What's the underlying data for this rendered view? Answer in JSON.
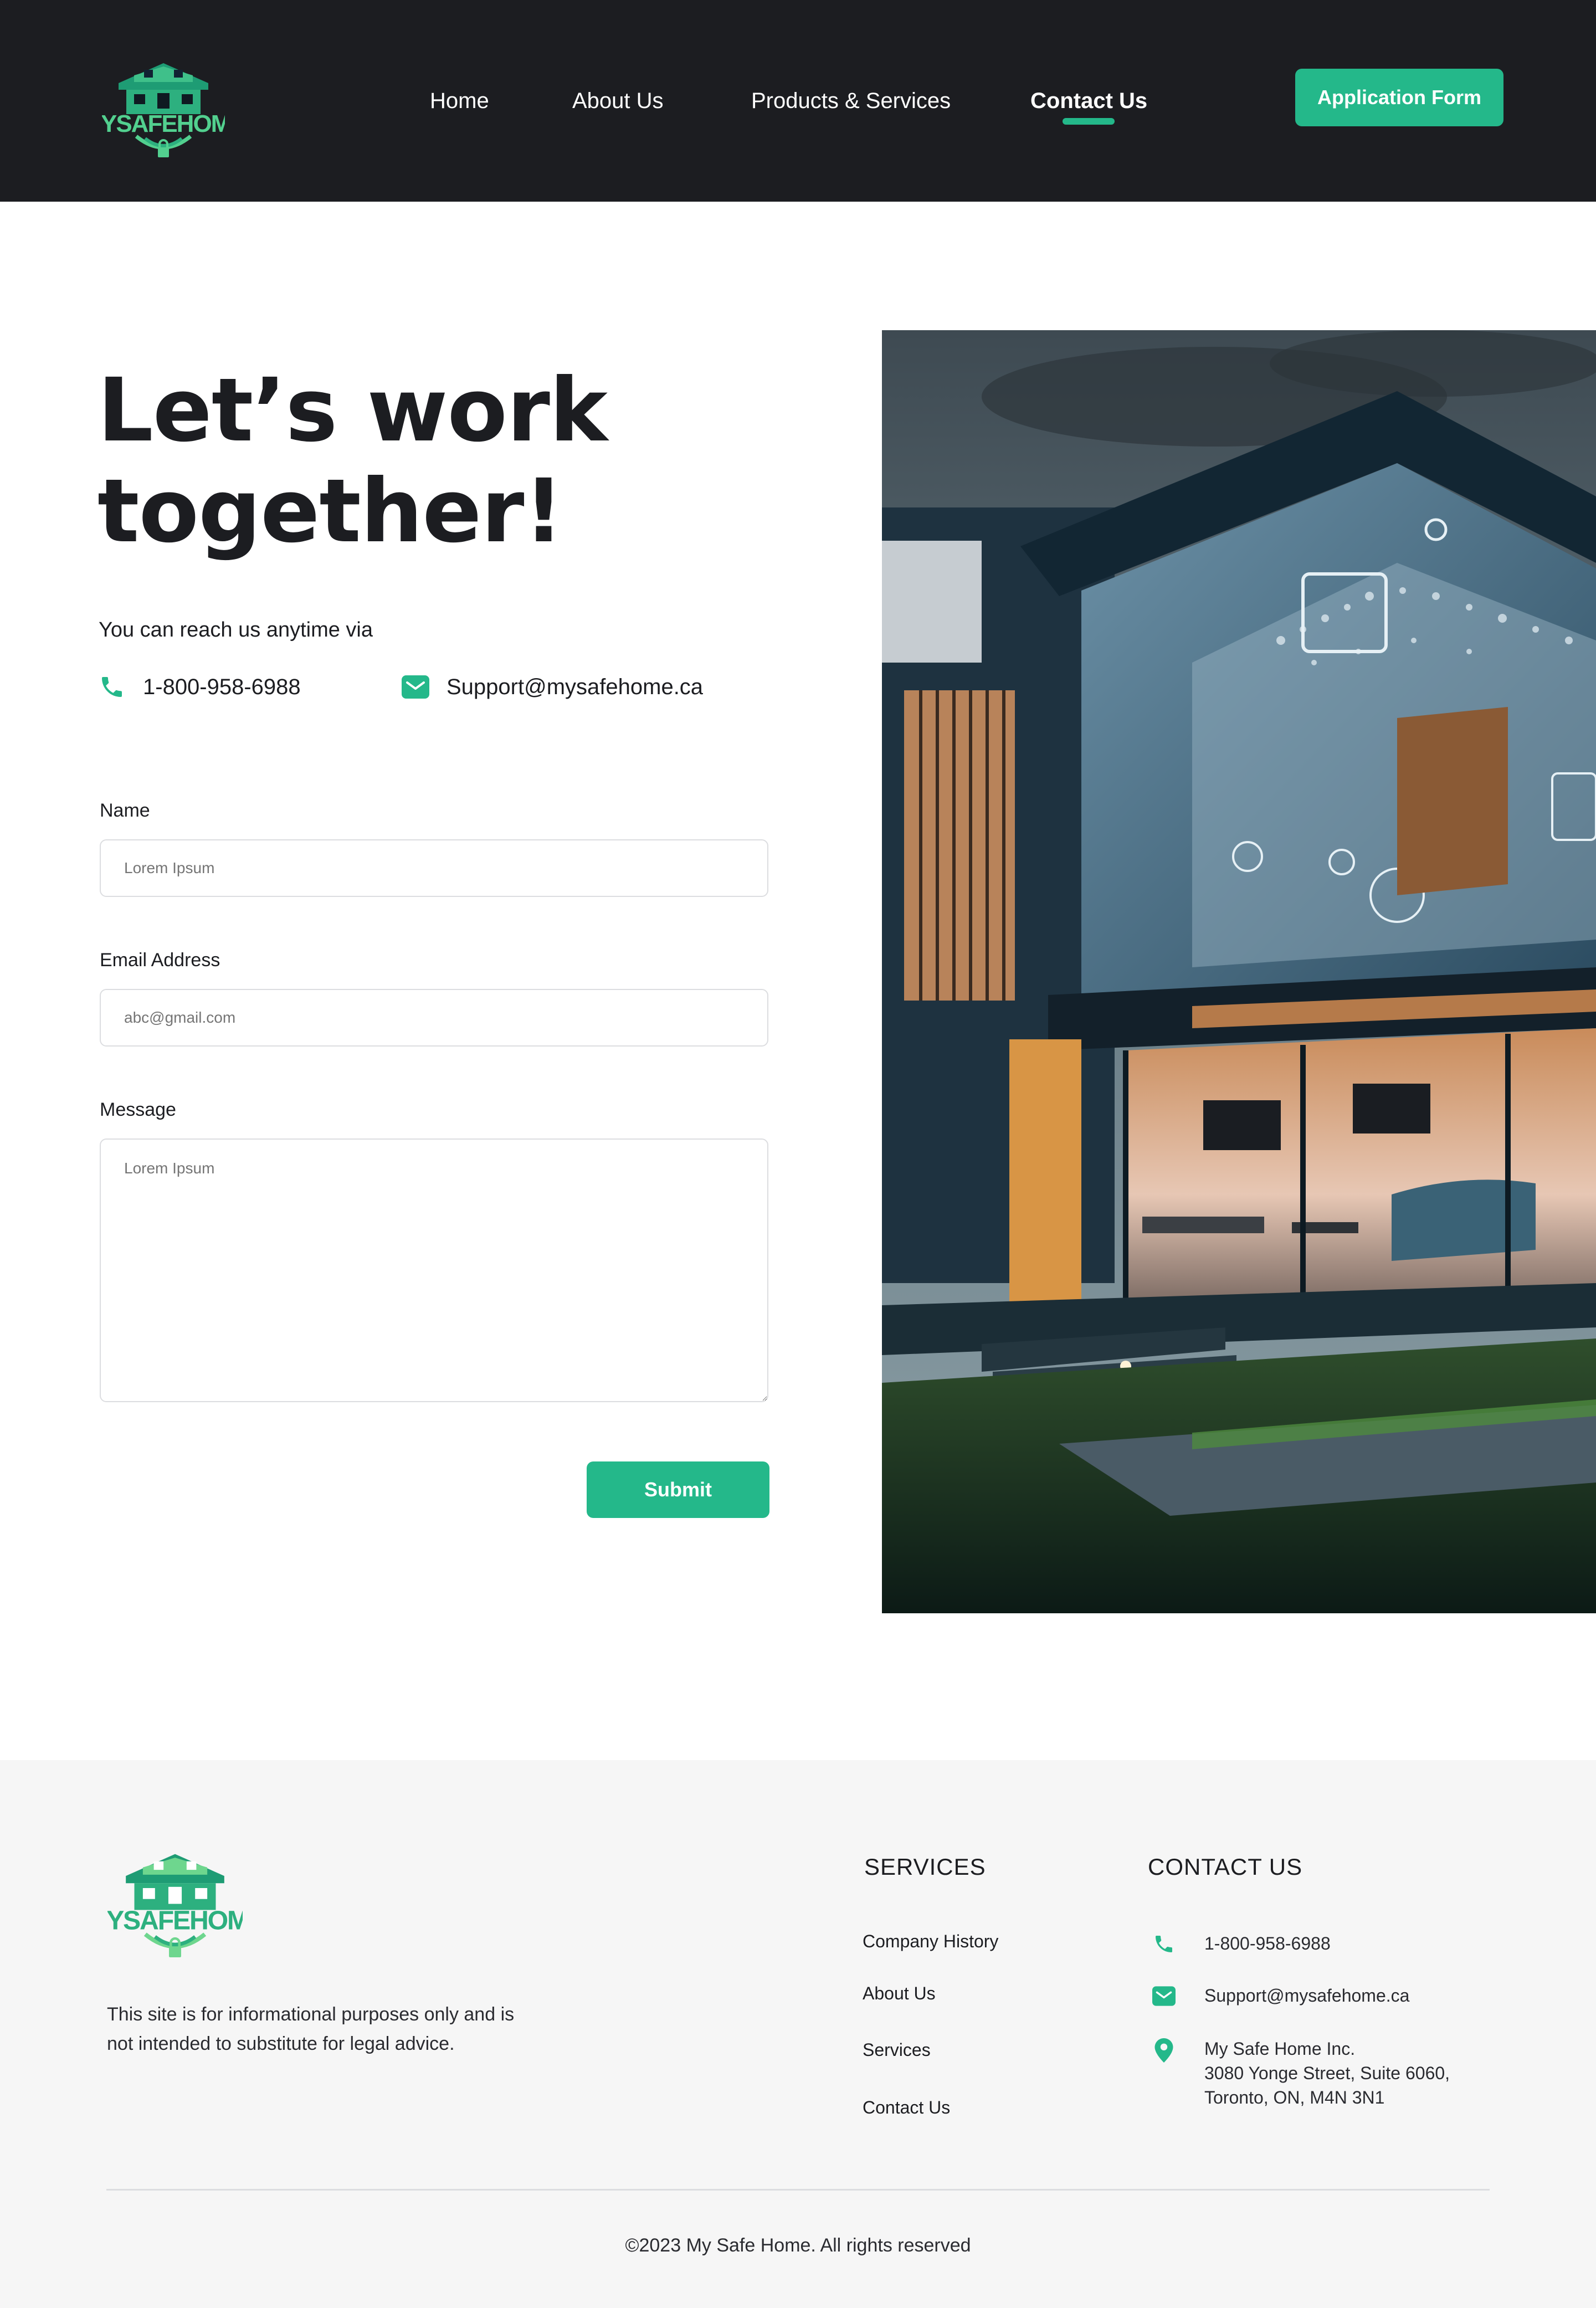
{
  "brand": {
    "logo_text": "MYSAFEHOME",
    "accent": "#24b88a",
    "dark": "#1c1d21"
  },
  "nav": {
    "items": [
      {
        "label": "Home"
      },
      {
        "label": "About  Us"
      },
      {
        "label": "Products & Services"
      },
      {
        "label": "Contact Us",
        "active": true
      }
    ],
    "cta_label": "Application Form"
  },
  "hero": {
    "title_line1": "Let’s work",
    "title_line2": "together!",
    "reach_text": "You can reach us anytime via",
    "phone": "1-800-958-6988",
    "email": "Support@mysafehome.ca"
  },
  "form": {
    "name_label": "Name",
    "name_placeholder": "Lorem Ipsum",
    "email_label": "Email Address",
    "email_placeholder": "abc@gmail.com",
    "message_label": "Message",
    "message_placeholder": "Lorem Ipsum",
    "submit_label": "Submit"
  },
  "footer": {
    "disclaimer": "This site is for informational purposes only and is not intended to substitute for legal advice.",
    "services_heading": "SERVICES",
    "services": [
      "Company History",
      "About Us",
      "Services",
      "Contact Us"
    ],
    "contact_heading": "CONTACT US",
    "phone": "1-800-958-6988",
    "email": "Support@mysafehome.ca",
    "address_line1": "My Safe Home Inc.",
    "address_line2": "3080 Yonge Street, Suite 6060,",
    "address_line3": "Toronto, ON, M4N 3N1",
    "copyright": "©2023 My Safe Home. All rights reserved"
  },
  "icons": {
    "phone": "phone-icon",
    "email": "mail-icon",
    "location": "location-pin-icon"
  }
}
